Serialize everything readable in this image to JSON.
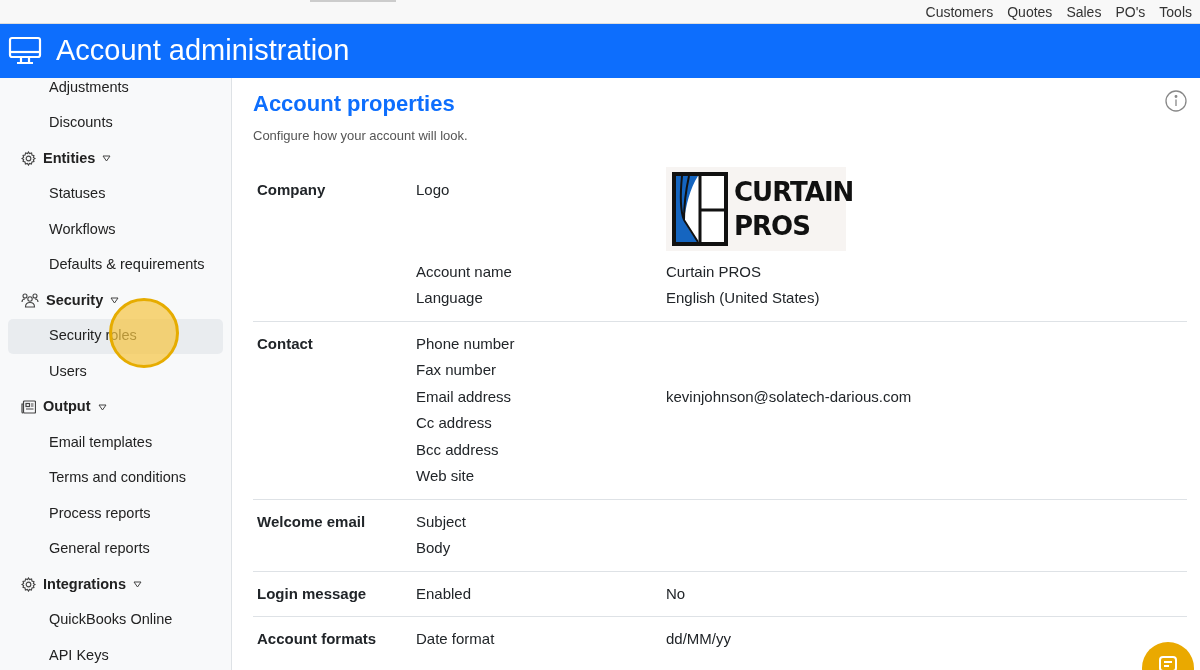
{
  "top_nav": [
    "Customers",
    "Quotes",
    "Sales",
    "PO's",
    "Tools"
  ],
  "header": {
    "title": "Account administration"
  },
  "sidebar": {
    "items": [
      {
        "kind": "item",
        "label": "Adjustments",
        "selected": false
      },
      {
        "kind": "item",
        "label": "Discounts",
        "selected": false
      },
      {
        "kind": "group",
        "label": "Entities",
        "expanded": true,
        "children": [
          {
            "label": "Statuses",
            "selected": false
          },
          {
            "label": "Workflows",
            "selected": false
          },
          {
            "label": "Defaults & requirements",
            "selected": false
          }
        ]
      },
      {
        "kind": "group",
        "label": "Security",
        "expanded": true,
        "children": [
          {
            "label": "Security roles",
            "selected": true
          },
          {
            "label": "Users",
            "selected": false
          }
        ]
      },
      {
        "kind": "group",
        "label": "Output",
        "expanded": true,
        "children": [
          {
            "label": "Email templates",
            "selected": false
          },
          {
            "label": "Terms and conditions",
            "selected": false
          },
          {
            "label": "Process reports",
            "selected": false
          },
          {
            "label": "General reports",
            "selected": false
          }
        ]
      },
      {
        "kind": "group",
        "label": "Integrations",
        "expanded": true,
        "children": [
          {
            "label": "QuickBooks Online",
            "selected": false
          },
          {
            "label": "API Keys",
            "selected": false
          }
        ]
      }
    ]
  },
  "main": {
    "title": "Account properties",
    "subtitle": "Configure how your account will look.",
    "sections": [
      {
        "label": "Company",
        "fields": [
          {
            "kind": "logo",
            "name": "Logo",
            "logo_text": [
              "CURTAIN",
              "PROS"
            ]
          },
          {
            "kind": "text",
            "name": "Account name",
            "value": "Curtain PROS"
          },
          {
            "kind": "text",
            "name": "Language",
            "value": "English (United States)"
          }
        ]
      },
      {
        "label": "Contact",
        "fields": [
          {
            "kind": "text",
            "name": "Phone number"
          },
          {
            "kind": "text",
            "name": "Fax number"
          },
          {
            "kind": "text",
            "name": "Email address",
            "value": "kevinjohnson@solatech-darious.com"
          },
          {
            "kind": "text",
            "name": "Cc address"
          },
          {
            "kind": "text",
            "name": "Bcc address"
          },
          {
            "kind": "text",
            "name": "Web site"
          }
        ]
      },
      {
        "label": "Welcome email",
        "fields": [
          {
            "kind": "text",
            "name": "Subject"
          },
          {
            "kind": "text",
            "name": "Body"
          }
        ]
      },
      {
        "label": "Login message",
        "fields": [
          {
            "kind": "text",
            "name": "Enabled",
            "value": "No"
          }
        ]
      },
      {
        "label": "Account formats",
        "fields": [
          {
            "kind": "text",
            "name": "Date format",
            "value": "dd/MM/yy"
          }
        ]
      }
    ]
  }
}
